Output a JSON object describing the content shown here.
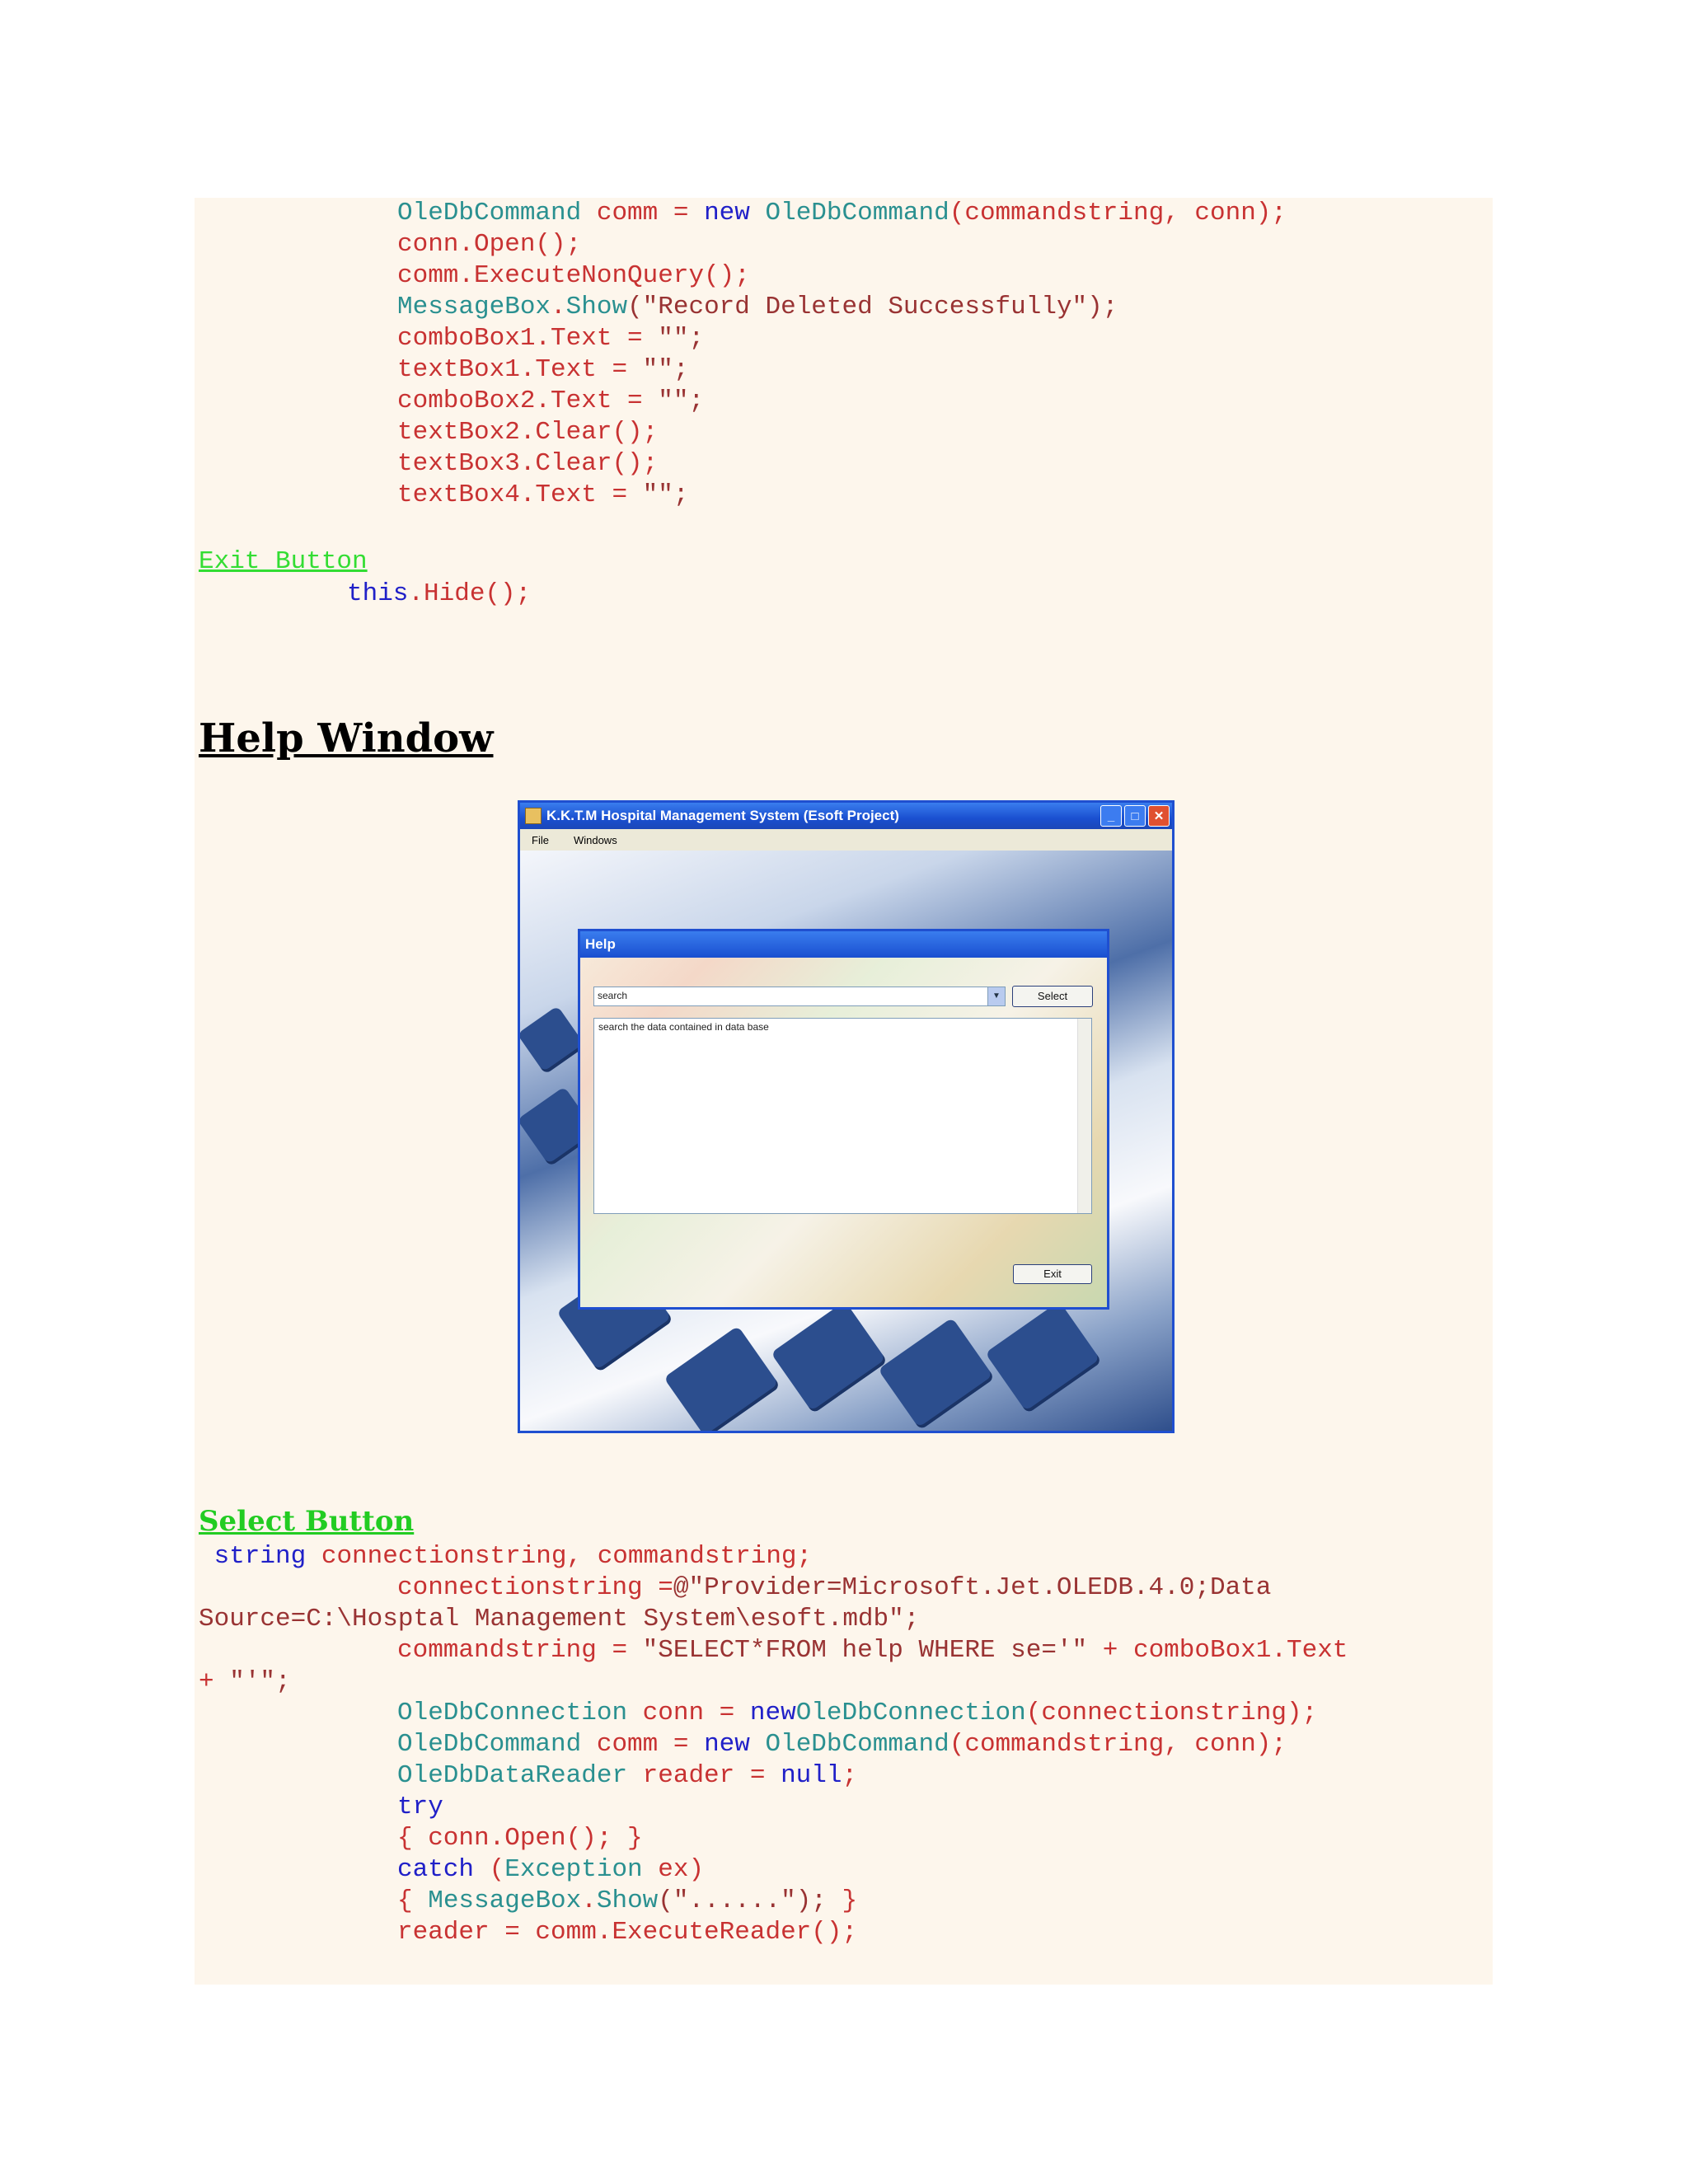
{
  "code_top": [
    [
      {
        "c": "t",
        "v": "OleDbCommand"
      },
      {
        "c": "r",
        "v": " comm = "
      },
      {
        "c": "k",
        "v": "new"
      },
      {
        "c": "r",
        "v": " "
      },
      {
        "c": "t",
        "v": "OleDbCommand"
      },
      {
        "c": "r",
        "v": "(commandstring, conn);"
      }
    ],
    [
      {
        "c": "r",
        "v": "conn.Open();"
      }
    ],
    [
      {
        "c": "r",
        "v": "comm.ExecuteNonQuery();"
      }
    ],
    [
      {
        "c": "t",
        "v": "MessageBox"
      },
      {
        "c": "r",
        "v": "."
      },
      {
        "c": "t",
        "v": "Show"
      },
      {
        "c": "s",
        "v": "(\"Record Deleted Successfully\");"
      }
    ],
    [
      {
        "c": "r",
        "v": "comboBox1.Text = "
      },
      {
        "c": "s",
        "v": "\"\";"
      }
    ],
    [
      {
        "c": "r",
        "v": "textBox1.Text = "
      },
      {
        "c": "s",
        "v": "\"\";"
      }
    ],
    [
      {
        "c": "r",
        "v": "comboBox2.Text = "
      },
      {
        "c": "s",
        "v": "\"\";"
      }
    ],
    [
      {
        "c": "r",
        "v": "textBox2.Clear();"
      }
    ],
    [
      {
        "c": "r",
        "v": "textBox3.Clear();"
      }
    ],
    [
      {
        "c": "r",
        "v": "textBox4.Text = "
      },
      {
        "c": "s",
        "v": "\"\";"
      }
    ]
  ],
  "exit_button_label": "Exit Button",
  "exit_code": [
    [
      {
        "c": "k",
        "v": "this"
      },
      {
        "c": "r",
        "v": ".Hide();"
      }
    ]
  ],
  "help_heading": "Help Window",
  "screenshot": {
    "window_title": "K.K.T.M Hospital Management System (Esoft Project)",
    "menu": [
      "File",
      "Windows"
    ],
    "dialog_title": "Help",
    "combo_value": "search",
    "select_button": "Select",
    "memo_text": "search the data contained in data base",
    "exit_button": "Exit"
  },
  "select_heading": "Select Button",
  "code_bottom": [
    {
      "indent": 0,
      "tokens": [
        {
          "c": "k",
          "v": " string"
        },
        {
          "c": "r",
          "v": " connectionstring, commandstring;"
        }
      ]
    },
    {
      "indent": 1,
      "tokens": [
        {
          "c": "r",
          "v": "connectionstring ="
        },
        {
          "c": "s",
          "v": "@\"Provider=Microsoft.Jet.OLEDB.4.0;Data"
        }
      ]
    },
    {
      "indent": 0,
      "tokens": [
        {
          "c": "s",
          "v": "Source=C:\\Hosptal Management System\\esoft.mdb\";"
        }
      ]
    },
    {
      "indent": 1,
      "tokens": [
        {
          "c": "r",
          "v": "commandstring = "
        },
        {
          "c": "s",
          "v": "\"SELECT*FROM help WHERE se='\""
        },
        {
          "c": "r",
          "v": " + comboBox1.Text"
        }
      ]
    },
    {
      "indent": 0,
      "tokens": [
        {
          "c": "r",
          "v": "+ "
        },
        {
          "c": "s",
          "v": "\"'\";"
        }
      ]
    },
    {
      "indent": 1,
      "tokens": [
        {
          "c": "t",
          "v": "OleDbConnection"
        },
        {
          "c": "r",
          "v": " conn = "
        },
        {
          "c": "k",
          "v": "new"
        },
        {
          "c": "t",
          "v": "OleDbConnection"
        },
        {
          "c": "r",
          "v": "(connectionstring);"
        }
      ]
    },
    {
      "indent": 1,
      "tokens": [
        {
          "c": "t",
          "v": "OleDbCommand"
        },
        {
          "c": "r",
          "v": " comm = "
        },
        {
          "c": "k",
          "v": "new"
        },
        {
          "c": "r",
          "v": " "
        },
        {
          "c": "t",
          "v": "OleDbCommand"
        },
        {
          "c": "r",
          "v": "(commandstring, conn);"
        }
      ]
    },
    {
      "indent": 1,
      "tokens": [
        {
          "c": "t",
          "v": "OleDbDataReader"
        },
        {
          "c": "r",
          "v": " reader = "
        },
        {
          "c": "k",
          "v": "null"
        },
        {
          "c": "r",
          "v": ";"
        }
      ]
    },
    {
      "indent": 1,
      "tokens": [
        {
          "c": "k",
          "v": "try"
        }
      ]
    },
    {
      "indent": 1,
      "tokens": [
        {
          "c": "r",
          "v": "{ conn.Open(); }"
        }
      ]
    },
    {
      "indent": 1,
      "tokens": [
        {
          "c": "k",
          "v": "catch"
        },
        {
          "c": "r",
          "v": " ("
        },
        {
          "c": "t",
          "v": "Exception"
        },
        {
          "c": "r",
          "v": " ex)"
        }
      ]
    },
    {
      "indent": 1,
      "tokens": [
        {
          "c": "r",
          "v": "{ "
        },
        {
          "c": "t",
          "v": "MessageBox"
        },
        {
          "c": "r",
          "v": "."
        },
        {
          "c": "t",
          "v": "Show"
        },
        {
          "c": "s",
          "v": "(\"......\");"
        },
        {
          "c": "r",
          "v": " }"
        }
      ]
    },
    {
      "indent": 1,
      "tokens": [
        {
          "c": "r",
          "v": "reader = comm.ExecuteReader();"
        }
      ]
    }
  ]
}
